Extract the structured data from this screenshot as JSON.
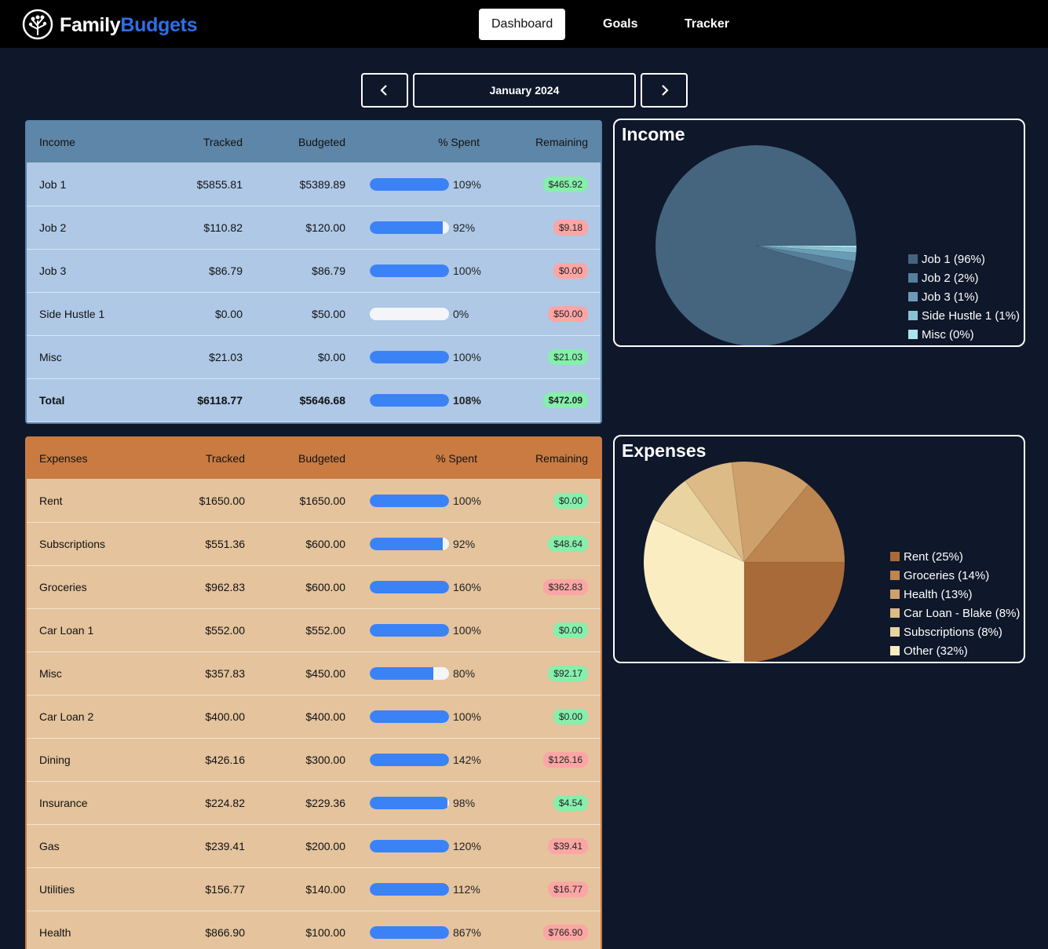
{
  "brand": {
    "part1": "Family",
    "part2": "Budgets"
  },
  "nav": {
    "dashboard": "Dashboard",
    "goals": "Goals",
    "tracker": "Tracker"
  },
  "month": {
    "label": "January 2024"
  },
  "income_table": {
    "headers": {
      "name": "Income",
      "tracked": "Tracked",
      "budgeted": "Budgeted",
      "pct": "% Spent",
      "remaining": "Remaining"
    },
    "rows": [
      {
        "name": "Job 1",
        "tracked": "$5855.81",
        "budgeted": "$5389.89",
        "pct": "109%",
        "fill": 1.0,
        "remaining": "$465.92",
        "status": "pos"
      },
      {
        "name": "Job 2",
        "tracked": "$110.82",
        "budgeted": "$120.00",
        "pct": "92%",
        "fill": 0.92,
        "remaining": "$9.18",
        "status": "neg"
      },
      {
        "name": "Job 3",
        "tracked": "$86.79",
        "budgeted": "$86.79",
        "pct": "100%",
        "fill": 1.0,
        "remaining": "$0.00",
        "status": "neg"
      },
      {
        "name": "Side Hustle 1",
        "tracked": "$0.00",
        "budgeted": "$50.00",
        "pct": "0%",
        "fill": 0.0,
        "remaining": "$50.00",
        "status": "neg"
      },
      {
        "name": "Misc",
        "tracked": "$21.03",
        "budgeted": "$0.00",
        "pct": "100%",
        "fill": 1.0,
        "remaining": "$21.03",
        "status": "pos"
      }
    ],
    "total": {
      "name": "Total",
      "tracked": "$6118.77",
      "budgeted": "$5646.68",
      "pct": "108%",
      "fill": 1.0,
      "remaining": "$472.09",
      "status": "pos"
    }
  },
  "expense_table": {
    "headers": {
      "name": "Expenses",
      "tracked": "Tracked",
      "budgeted": "Budgeted",
      "pct": "% Spent",
      "remaining": "Remaining"
    },
    "rows": [
      {
        "name": "Rent",
        "tracked": "$1650.00",
        "budgeted": "$1650.00",
        "pct": "100%",
        "fill": 1.0,
        "remaining": "$0.00",
        "status": "pos"
      },
      {
        "name": "Subscriptions",
        "tracked": "$551.36",
        "budgeted": "$600.00",
        "pct": "92%",
        "fill": 0.92,
        "remaining": "$48.64",
        "status": "pos"
      },
      {
        "name": "Groceries",
        "tracked": "$962.83",
        "budgeted": "$600.00",
        "pct": "160%",
        "fill": 1.0,
        "remaining": "$362.83",
        "status": "neg"
      },
      {
        "name": "Car Loan 1",
        "tracked": "$552.00",
        "budgeted": "$552.00",
        "pct": "100%",
        "fill": 1.0,
        "remaining": "$0.00",
        "status": "pos"
      },
      {
        "name": "Misc",
        "tracked": "$357.83",
        "budgeted": "$450.00",
        "pct": "80%",
        "fill": 0.8,
        "remaining": "$92.17",
        "status": "pos"
      },
      {
        "name": "Car Loan 2",
        "tracked": "$400.00",
        "budgeted": "$400.00",
        "pct": "100%",
        "fill": 1.0,
        "remaining": "$0.00",
        "status": "pos"
      },
      {
        "name": "Dining",
        "tracked": "$426.16",
        "budgeted": "$300.00",
        "pct": "142%",
        "fill": 1.0,
        "remaining": "$126.16",
        "status": "neg"
      },
      {
        "name": "Insurance",
        "tracked": "$224.82",
        "budgeted": "$229.36",
        "pct": "98%",
        "fill": 0.98,
        "remaining": "$4.54",
        "status": "pos"
      },
      {
        "name": "Gas",
        "tracked": "$239.41",
        "budgeted": "$200.00",
        "pct": "120%",
        "fill": 1.0,
        "remaining": "$39.41",
        "status": "neg"
      },
      {
        "name": "Utilities",
        "tracked": "$156.77",
        "budgeted": "$140.00",
        "pct": "112%",
        "fill": 1.0,
        "remaining": "$16.77",
        "status": "neg"
      },
      {
        "name": "Health",
        "tracked": "$866.90",
        "budgeted": "$100.00",
        "pct": "867%",
        "fill": 1.0,
        "remaining": "$766.90",
        "status": "neg"
      }
    ]
  },
  "colors": {
    "positive": "#86efac",
    "negative": "#fca5a5",
    "bar": "#3b82f6"
  },
  "chart_data": [
    {
      "type": "pie",
      "title": "Income",
      "legend_position": "right",
      "slices": [
        {
          "label": "Job 1 (96%)",
          "value": 95.7,
          "color": "#45657f"
        },
        {
          "label": "Job 2 (2%)",
          "value": 1.8,
          "color": "#577f9b"
        },
        {
          "label": "Job 3 (1%)",
          "value": 1.4,
          "color": "#6b9cb5"
        },
        {
          "label": "Side Hustle 1 (1%)",
          "value": 0.75,
          "color": "#89c3d1"
        },
        {
          "label": "Misc (0%)",
          "value": 0.35,
          "color": "#a9e4f0"
        }
      ]
    },
    {
      "type": "pie",
      "title": "Expenses",
      "legend_position": "right",
      "slices": [
        {
          "label": "Rent (25%)",
          "value": 25,
          "color": "#a96a39"
        },
        {
          "label": "Groceries (14%)",
          "value": 14,
          "color": "#bd854f"
        },
        {
          "label": "Health (13%)",
          "value": 13,
          "color": "#cea06b"
        },
        {
          "label": "Car Loan - Blake (8%)",
          "value": 8,
          "color": "#dcbb87"
        },
        {
          "label": "Subscriptions (8%)",
          "value": 8,
          "color": "#e9d3a1"
        },
        {
          "label": "Other (32%)",
          "value": 32,
          "color": "#fbedc2"
        }
      ]
    }
  ]
}
